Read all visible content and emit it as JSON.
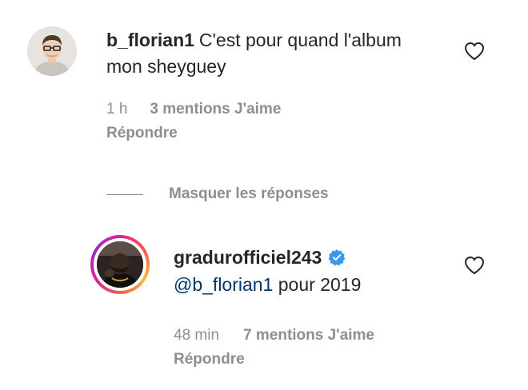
{
  "comment": {
    "username": "b_florian1",
    "text": "C'est pour quand l'album mon sheyguey",
    "time": "1 h",
    "likes": "3 mentions J'aime",
    "reply": "Répondre",
    "avatar_icon": "user-avatar-glasses",
    "like_icon": "heart-outline-icon"
  },
  "hide_replies": "Masquer les réponses",
  "reply_comment": {
    "username": "gradurofficiel243",
    "verified_icon": "verified-badge-icon",
    "mention": "@b_florian1",
    "text": "pour 2019",
    "time": "48 min",
    "likes": "7 mentions J'aime",
    "reply": "Répondre",
    "avatar_icon": "user-avatar-story-ring",
    "like_icon": "heart-outline-icon"
  },
  "colors": {
    "text": "#262626",
    "secondary": "#8e8e8e",
    "mention": "#003569",
    "verified": "#3897f0"
  }
}
